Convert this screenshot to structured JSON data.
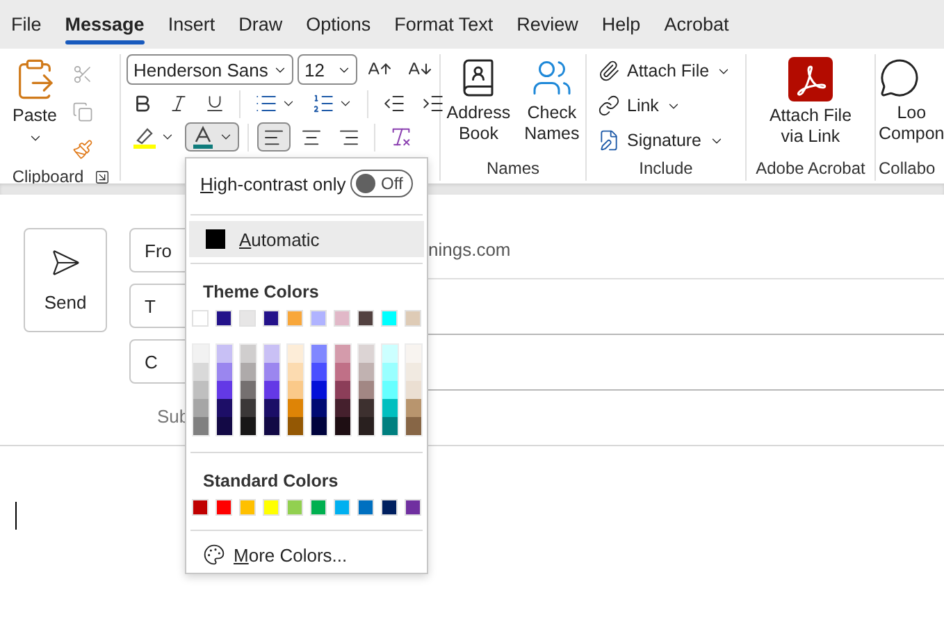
{
  "menu_tabs": [
    {
      "label": "File",
      "selected": false
    },
    {
      "label": "Message",
      "selected": true
    },
    {
      "label": "Insert",
      "selected": false
    },
    {
      "label": "Draw",
      "selected": false
    },
    {
      "label": "Options",
      "selected": false
    },
    {
      "label": "Format Text",
      "selected": false
    },
    {
      "label": "Review",
      "selected": false
    },
    {
      "label": "Help",
      "selected": false
    },
    {
      "label": "Acrobat",
      "selected": false
    }
  ],
  "ribbon": {
    "clipboard": {
      "paste": "Paste",
      "label": "Clipboard"
    },
    "font": {
      "font_name": "Henderson Sans",
      "font_size": "12",
      "font_color_expanded": true,
      "alignment": [
        {
          "kind": "left",
          "selected": true
        },
        {
          "kind": "center",
          "selected": false
        },
        {
          "kind": "right",
          "selected": false
        }
      ]
    },
    "names": {
      "label": "Names",
      "buttons": [
        {
          "kind": "address",
          "lines": [
            "Address",
            "Book"
          ]
        },
        {
          "kind": "check",
          "lines": [
            "Check",
            "Names"
          ]
        }
      ]
    },
    "include": {
      "label": "Include",
      "items": [
        {
          "kind": "attach",
          "label": "Attach File"
        },
        {
          "kind": "link",
          "label": "Link"
        },
        {
          "kind": "signature",
          "label": "Signature"
        }
      ]
    },
    "acrobat": {
      "label": "Adobe Acrobat",
      "lines": [
        "Attach File",
        "via Link"
      ]
    },
    "collab": {
      "label": "Collabo",
      "lines": [
        "Loo",
        "Compon"
      ]
    }
  },
  "compose": {
    "send": "Send",
    "fields": [
      {
        "label": "Fro",
        "value": "nings.com"
      },
      {
        "label": "T"
      },
      {
        "label": "C"
      }
    ],
    "subject_label": "Sub"
  },
  "dropdown": {
    "high_contrast": {
      "label": "High-contrast only",
      "on": false,
      "state_text": "Off"
    },
    "automatic": "Automatic",
    "theme_title": "Theme Colors",
    "theme_row": [
      {
        "color": "#ffffff"
      },
      {
        "color": "#23128a"
      },
      {
        "color": "#e7e6e6"
      },
      {
        "color": "#24128a"
      },
      {
        "color": "#f8a73b"
      },
      {
        "color": "#b0b3ff"
      },
      {
        "color": "#e1b8c8"
      },
      {
        "color": "#524140"
      },
      {
        "color": "#00ffff"
      },
      {
        "color": "#decbb6"
      }
    ],
    "theme_shades": [
      {
        "shades": [
          {
            "color": "#f2f2f2"
          },
          {
            "color": "#d9d9d9"
          },
          {
            "color": "#bfbfbf"
          },
          {
            "color": "#a6a6a6"
          },
          {
            "color": "#808080"
          }
        ]
      },
      {
        "shades": [
          {
            "color": "#c8c0f5"
          },
          {
            "color": "#9a86ef"
          },
          {
            "color": "#6339e6"
          },
          {
            "color": "#1d0e67"
          },
          {
            "color": "#130945"
          }
        ]
      },
      {
        "shades": [
          {
            "color": "#d0cece"
          },
          {
            "color": "#aeaaaa"
          },
          {
            "color": "#757070"
          },
          {
            "color": "#3b3838"
          },
          {
            "color": "#181717"
          }
        ]
      },
      {
        "shades": [
          {
            "color": "#c9c0f5"
          },
          {
            "color": "#9b86ef"
          },
          {
            "color": "#6439e6"
          },
          {
            "color": "#1b0e67"
          },
          {
            "color": "#120945"
          }
        ]
      },
      {
        "shades": [
          {
            "color": "#fdedd8"
          },
          {
            "color": "#fcdbb0"
          },
          {
            "color": "#fac989"
          },
          {
            "color": "#de8406"
          },
          {
            "color": "#945804"
          }
        ]
      },
      {
        "shades": [
          {
            "color": "#8087ff"
          },
          {
            "color": "#4a4fff"
          },
          {
            "color": "#0410d8"
          },
          {
            "color": "#000a73"
          },
          {
            "color": "#00033d"
          }
        ]
      },
      {
        "shades": [
          {
            "color": "#d49bab"
          },
          {
            "color": "#c07087"
          },
          {
            "color": "#8c3e59"
          },
          {
            "color": "#45202d"
          },
          {
            "color": "#1e0e13"
          }
        ]
      },
      {
        "shades": [
          {
            "color": "#dcd4d4"
          },
          {
            "color": "#c1b2b1"
          },
          {
            "color": "#a28784"
          },
          {
            "color": "#3d302f"
          },
          {
            "color": "#29201f"
          }
        ]
      },
      {
        "shades": [
          {
            "color": "#ccffff"
          },
          {
            "color": "#99ffff"
          },
          {
            "color": "#66ffff"
          },
          {
            "color": "#00bfbf"
          },
          {
            "color": "#007f7f"
          }
        ]
      },
      {
        "shades": [
          {
            "color": "#f8f4f0"
          },
          {
            "color": "#f1eae1"
          },
          {
            "color": "#ebdfd2"
          },
          {
            "color": "#b8956e"
          },
          {
            "color": "#876646"
          }
        ]
      }
    ],
    "standard_title": "Standard Colors",
    "standard": [
      {
        "color": "#c00000"
      },
      {
        "color": "#ff0000"
      },
      {
        "color": "#ffc000"
      },
      {
        "color": "#ffff00"
      },
      {
        "color": "#92d050"
      },
      {
        "color": "#00b050"
      },
      {
        "color": "#00b0f0"
      },
      {
        "color": "#0070c0"
      },
      {
        "color": "#002060"
      },
      {
        "color": "#7030a0"
      }
    ],
    "more": "More Colors..."
  }
}
